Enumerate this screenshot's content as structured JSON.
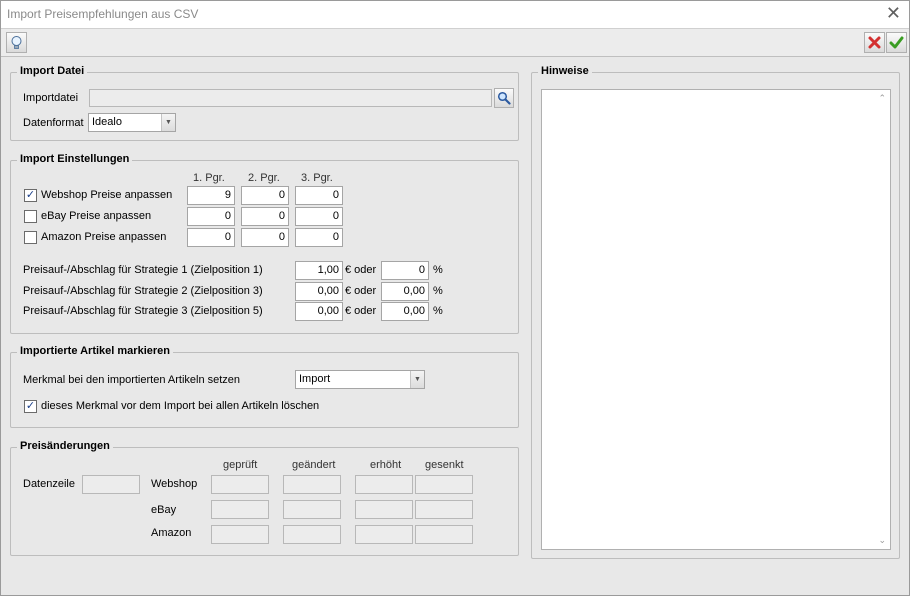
{
  "window": {
    "title": "Import Preisempfehlungen aus CSV"
  },
  "icons": {
    "close": "close-x-icon",
    "hint": "lightbulb-icon",
    "cancel": "red-x-icon",
    "ok": "green-check-icon",
    "browse": "magnifier-icon"
  },
  "colors": {
    "cancel": "#d32f2f",
    "ok": "#3a9d23"
  },
  "import_datei": {
    "title": "Import Datei",
    "file_label": "Importdatei",
    "file_value": "",
    "format_label": "Datenformat",
    "format_value": "Idealo"
  },
  "einstellungen": {
    "title": "Import Einstellungen",
    "col_headers": [
      "1. Pgr.",
      "2. Pgr.",
      "3. Pgr."
    ],
    "rows": [
      {
        "label": "Webshop Preise anpassen",
        "checked": true,
        "values": [
          "9",
          "0",
          "0"
        ]
      },
      {
        "label": "eBay Preise anpassen",
        "checked": false,
        "values": [
          "0",
          "0",
          "0"
        ]
      },
      {
        "label": "Amazon Preise anpassen",
        "checked": false,
        "values": [
          "0",
          "0",
          "0"
        ]
      }
    ],
    "strategies": [
      {
        "label": "Preisauf-/Abschlag für Strategie 1 (Zielposition 1)",
        "euro": "1,00",
        "percent": "0"
      },
      {
        "label": "Preisauf-/Abschlag für Strategie 2 (Zielposition 3)",
        "euro": "0,00",
        "percent": "0,00"
      },
      {
        "label": "Preisauf-/Abschlag für Strategie 3 (Zielposition 5)",
        "euro": "0,00",
        "percent": "0,00"
      }
    ],
    "euro_suffix": "€ oder",
    "percent_suffix": "%"
  },
  "markieren": {
    "title": "Importierte Artikel markieren",
    "merkmal_label": "Merkmal bei den importierten Artikeln setzen",
    "merkmal_value": "Import",
    "delete_label": "dieses Merkmal vor dem Import bei allen Artikeln  löschen",
    "delete_checked": true
  },
  "aenderungen": {
    "title": "Preisänderungen",
    "datenzeile_label": "Datenzeile",
    "datenzeile_value": "",
    "col_headers": [
      "geprüft",
      "geändert",
      "erhöht",
      "gesenkt"
    ],
    "rows": [
      "Webshop",
      "eBay",
      "Amazon"
    ]
  },
  "hinweise": {
    "title": "Hinweise",
    "text": ""
  }
}
